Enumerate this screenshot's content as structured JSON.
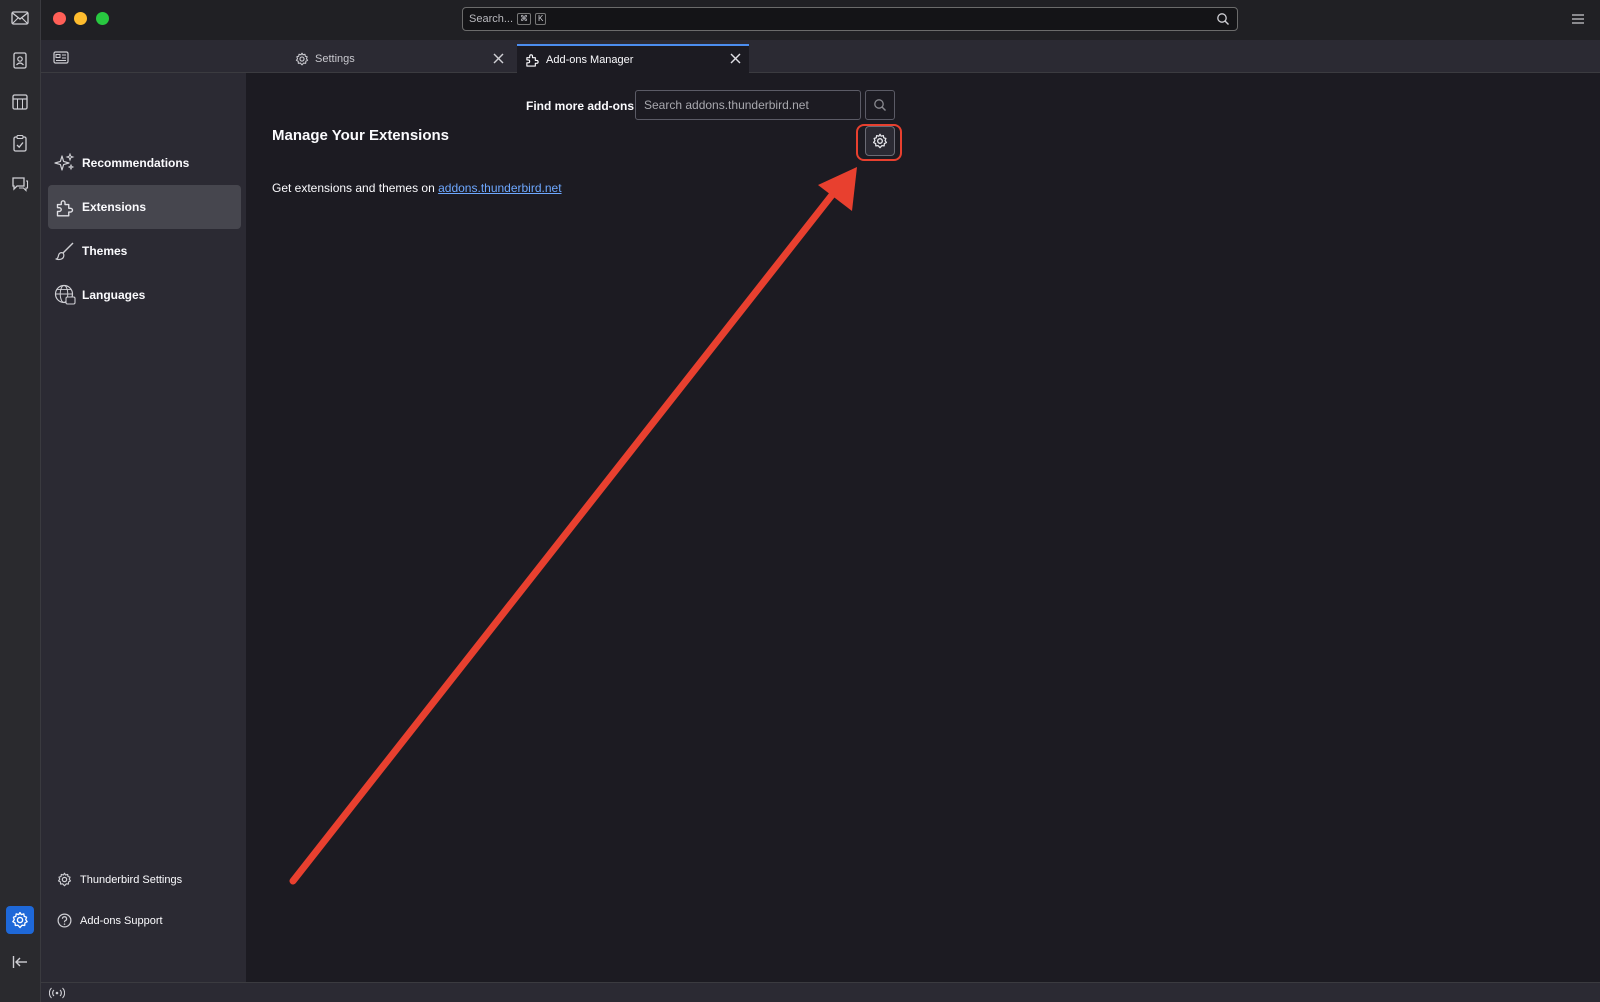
{
  "titlebar": {
    "search_placeholder": "Search...",
    "shortcut_keys": [
      "⌘",
      "K"
    ]
  },
  "spaces": {
    "items": [
      "mail-icon",
      "address-book-icon",
      "calendar-icon",
      "tasks-icon",
      "chat-icon"
    ],
    "active": "settings-icon"
  },
  "tabs": [
    {
      "label": "Settings",
      "icon": "gear-icon",
      "active": false
    },
    {
      "label": "Add-ons Manager",
      "icon": "puzzle-icon",
      "active": true
    }
  ],
  "sidebar": {
    "categories": [
      {
        "label": "Recommendations",
        "icon": "sparkle-icon",
        "selected": false
      },
      {
        "label": "Extensions",
        "icon": "puzzle-icon",
        "selected": true
      },
      {
        "label": "Themes",
        "icon": "brush-icon",
        "selected": false
      },
      {
        "label": "Languages",
        "icon": "globe-icon",
        "selected": false
      }
    ],
    "footer_links": [
      {
        "label": "Thunderbird Settings",
        "icon": "gear-icon"
      },
      {
        "label": "Add-ons Support",
        "icon": "help-icon"
      }
    ]
  },
  "main": {
    "find_label": "Find more add-ons",
    "search_placeholder": "Search addons.thunderbird.net",
    "title": "Manage Your Extensions",
    "info_text": "Get extensions and themes on ",
    "info_link": "addons.thunderbird.net"
  },
  "colors": {
    "accent": "#1e68d8",
    "link": "#6ea8ff",
    "annotation": "#e8402f",
    "background": "#1c1b22",
    "sidebar": "#2b2a33"
  }
}
